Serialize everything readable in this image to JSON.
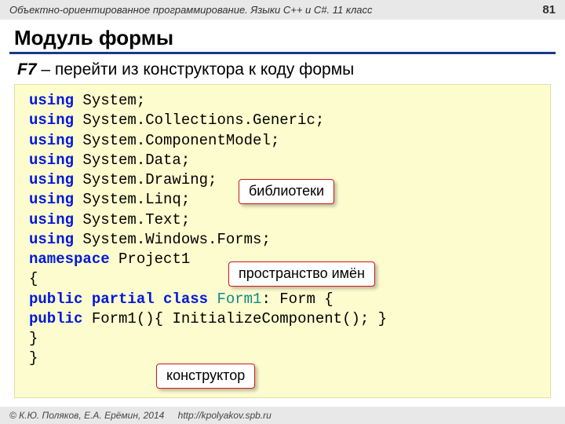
{
  "header": {
    "left": "Объектно-ориентированное программирование. Языки C++ и C#. 11 класс",
    "page": "81"
  },
  "title": "Модуль формы",
  "subtitle": {
    "key": "F7",
    "rest": " – перейти из конструктора к коду формы"
  },
  "code": {
    "lines": [
      [
        [
          "kw",
          "using"
        ],
        [
          "txt",
          " System;"
        ]
      ],
      [
        [
          "kw",
          "using"
        ],
        [
          "txt",
          " System.Collections.Generic;"
        ]
      ],
      [
        [
          "kw",
          "using"
        ],
        [
          "txt",
          " System.ComponentModel;"
        ]
      ],
      [
        [
          "kw",
          "using"
        ],
        [
          "txt",
          " System.Data;"
        ]
      ],
      [
        [
          "kw",
          "using"
        ],
        [
          "txt",
          " System.Drawing;"
        ]
      ],
      [
        [
          "kw",
          "using"
        ],
        [
          "txt",
          " System.Linq;"
        ]
      ],
      [
        [
          "kw",
          "using"
        ],
        [
          "txt",
          " System.Text;"
        ]
      ],
      [
        [
          "kw",
          "using"
        ],
        [
          "txt",
          " System.Windows.Forms;"
        ]
      ],
      [
        [
          "kw",
          "namespace"
        ],
        [
          "txt",
          " Project1"
        ]
      ],
      [
        [
          "txt",
          "{"
        ]
      ],
      [
        [
          "txt",
          " "
        ],
        [
          "kw",
          "public partial class"
        ],
        [
          "txt",
          " "
        ],
        [
          "cls",
          "Form1"
        ],
        [
          "txt",
          ": Form  {"
        ]
      ],
      [
        [
          "txt",
          "   "
        ],
        [
          "kw",
          "public"
        ],
        [
          "txt",
          " Form1(){ InitializeComponent(); }"
        ]
      ],
      [
        [
          "txt",
          "   }"
        ]
      ],
      [
        [
          "txt",
          "}"
        ]
      ]
    ]
  },
  "callouts": {
    "c1": "библиотеки",
    "c2": "пространство имён",
    "c3": "конструктор"
  },
  "footer": {
    "copyright": "© К.Ю. Поляков, Е.А. Ерёмин, 2014",
    "url": "http://kpolyakov.spb.ru"
  }
}
